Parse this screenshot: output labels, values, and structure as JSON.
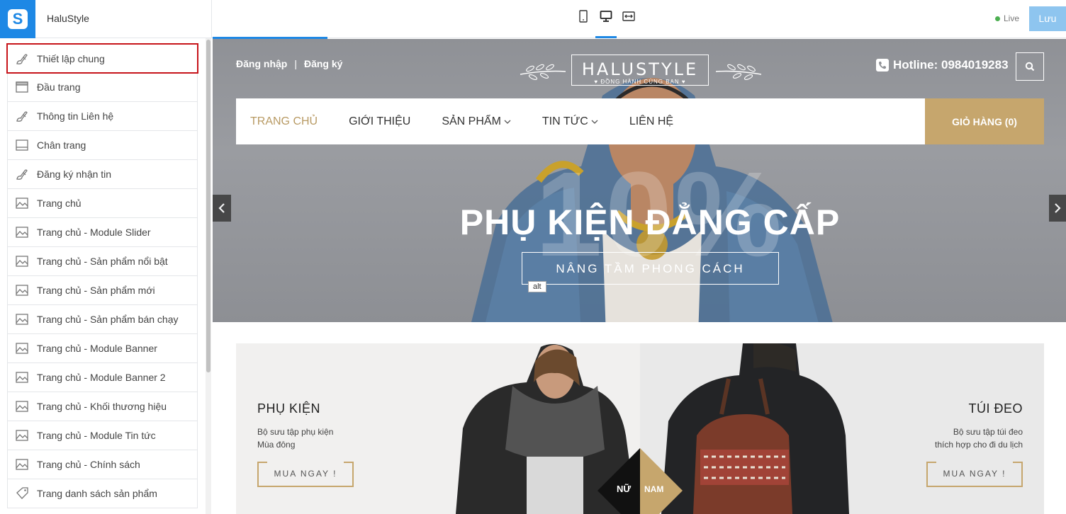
{
  "app": {
    "brand": "HaluStyle",
    "live_label": "Live",
    "save_label": "Lưu",
    "accent": "#1e88e5"
  },
  "devices": [
    "mobile-icon",
    "desktop-icon",
    "fullwidth-icon"
  ],
  "sidebar": {
    "items": [
      {
        "label": "Thiết lập chung",
        "icon": "brush-icon"
      },
      {
        "label": "Đầu trang",
        "icon": "header-icon"
      },
      {
        "label": "Thông tin Liên hệ",
        "icon": "brush-icon"
      },
      {
        "label": "Chân trang",
        "icon": "footer-icon"
      },
      {
        "label": "Đăng ký nhận tin",
        "icon": "brush-icon"
      },
      {
        "label": "Trang chủ",
        "icon": "image-icon"
      },
      {
        "label": "Trang chủ - Module Slider",
        "icon": "image-icon"
      },
      {
        "label": "Trang chủ - Sản phẩm nổi bật",
        "icon": "image-icon"
      },
      {
        "label": "Trang chủ - Sản phẩm mới",
        "icon": "image-icon"
      },
      {
        "label": "Trang chủ - Sản phẩm bán chạy",
        "icon": "image-icon"
      },
      {
        "label": "Trang chủ - Module Banner",
        "icon": "image-icon"
      },
      {
        "label": "Trang chủ - Module Banner 2",
        "icon": "image-icon"
      },
      {
        "label": "Trang chủ - Khối thương hiệu",
        "icon": "image-icon"
      },
      {
        "label": "Trang chủ - Module Tin tức",
        "icon": "image-icon"
      },
      {
        "label": "Trang chủ - Chính sách",
        "icon": "image-icon"
      },
      {
        "label": "Trang danh sách sản phẩm",
        "icon": "tag-icon"
      }
    ]
  },
  "site": {
    "login": "Đăng nhập",
    "separator": "|",
    "register": "Đăng ký",
    "logo_name": "HALUSTYLE",
    "logo_tagline": "♥ ĐỒNG HÀNH CÙNG BẠN ♥",
    "hotline": "Hotline: 0984019283",
    "nav": [
      "TRANG CHỦ",
      "GIỚI THIỆU",
      "SẢN PHẨM",
      "TIN TỨC",
      "LIÊN HỆ"
    ],
    "cart": "GIỎ HÀNG (0)",
    "gold": "#c6a66d",
    "hero": {
      "bg_number": "10%",
      "title": "PHỤ KIỆN ĐẲNG CẤP",
      "subtitle": "NÂNG TẦM PHONG CÁCH",
      "alt_tooltip": "alt"
    },
    "banners": {
      "left": {
        "title": "PHỤ KIỆN",
        "desc_line1": "Bộ sưu tập phụ kiện",
        "desc_line2": "Mùa đông",
        "button": "MUA NGAY !"
      },
      "right": {
        "title": "TÚI ĐEO",
        "desc_line1": "Bộ sưu tập túi đeo",
        "desc_line2": "thích hợp cho đi du lịch",
        "button": "MUA NGAY !"
      },
      "badge_left": "NỮ",
      "badge_right": "NAM"
    }
  }
}
